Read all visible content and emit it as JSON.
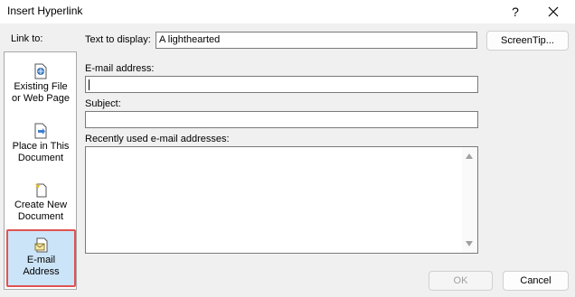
{
  "dialog": {
    "title": "Insert Hyperlink",
    "help_label": "?",
    "close_icon": "close-icon"
  },
  "linkbar": {
    "label": "Link to:",
    "items": [
      {
        "line1": "Existing File",
        "line2": "or Web Page",
        "icon": "file-web-icon"
      },
      {
        "line1": "Place in This",
        "line2": "Document",
        "icon": "place-document-icon"
      },
      {
        "line1": "Create New",
        "line2": "Document",
        "icon": "new-document-icon"
      },
      {
        "line1": "E-mail",
        "line2": "Address",
        "icon": "email-address-icon",
        "selected": true
      }
    ]
  },
  "form": {
    "display_label": "Text to display:",
    "display_value": "A lighthearted",
    "screentip_label": "ScreenTip...",
    "email_label": "E-mail address:",
    "email_value": "",
    "subject_label": "Subject:",
    "subject_value": "",
    "recent_label": "Recently used e-mail addresses:"
  },
  "footer": {
    "ok_label": "OK",
    "cancel_label": "Cancel"
  },
  "colors": {
    "selected_bg": "#cce4f7",
    "selected_border": "#e05252"
  }
}
